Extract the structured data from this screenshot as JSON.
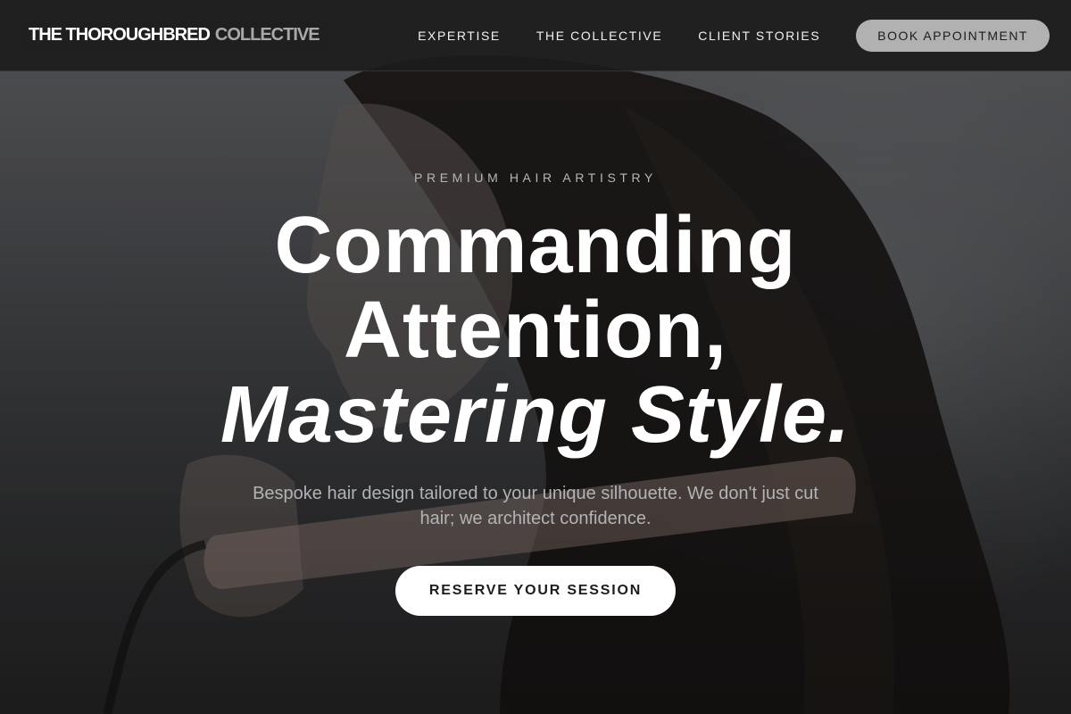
{
  "brand": {
    "name_primary": "THE THOROUGHBRED",
    "name_secondary": "COLLECTIVE"
  },
  "nav": {
    "items": [
      {
        "label": "EXPERTISE"
      },
      {
        "label": "THE COLLECTIVE"
      },
      {
        "label": "CLIENT STORIES"
      }
    ],
    "cta_label": "BOOK APPOINTMENT"
  },
  "hero": {
    "eyebrow": "PREMIUM HAIR ARTISTRY",
    "headline_line1": "Commanding",
    "headline_line2": "Attention,",
    "headline_line3": "Mastering Style.",
    "subcopy": "Bespoke hair design tailored to your unique silhouette. We don't just cut hair; we architect confidence.",
    "cta_label": "RESERVE YOUR SESSION",
    "background_image": "woman-with-hair-straightener-photo"
  },
  "colors": {
    "header_bg": "#1c1c1d",
    "book_button_bg": "#b1b1b1",
    "cta_bg": "#ffffff",
    "eyebrow_text": "#b6b6b6",
    "subcopy_text": "#b3b3b6"
  }
}
